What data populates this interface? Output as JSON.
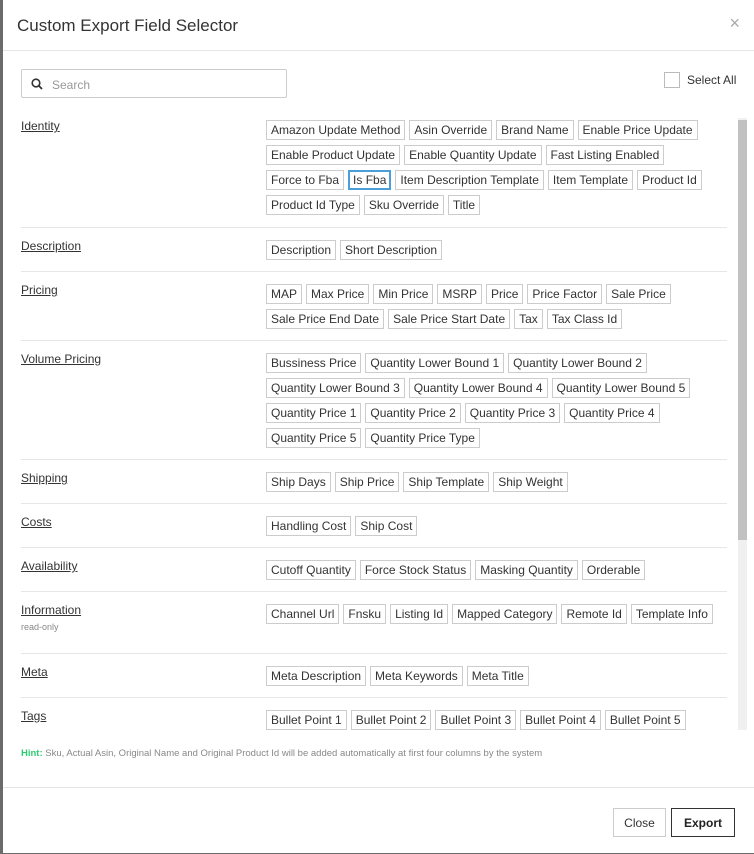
{
  "modal": {
    "title": "Custom Export Field Selector",
    "close_symbol": "×",
    "search": {
      "placeholder": "Search",
      "value": ""
    },
    "select_all_label": "Select All",
    "hint_label": "Hint:",
    "hint_text": "Sku, Actual Asin, Original Name and Original Product Id will be added automatically at first four columns by the system",
    "close_button": "Close",
    "export_button": "Export",
    "accent_color": "#4a9fd8",
    "hint_color": "#2ecc71"
  },
  "sections": [
    {
      "label": "Identity",
      "fields": [
        "Amazon Update Method",
        "Asin Override",
        "Brand Name",
        "Enable Price Update",
        "Enable Product Update",
        "Enable Quantity Update",
        "Fast Listing Enabled",
        "Force to Fba",
        "Is Fba",
        "Item Description Template",
        "Item Template",
        "Product Id",
        "Product Id Type",
        "Sku Override",
        "Title"
      ],
      "selected": [
        "Is Fba"
      ]
    },
    {
      "label": "Description",
      "fields": [
        "Description",
        "Short Description"
      ]
    },
    {
      "label": "Pricing",
      "fields": [
        "MAP",
        "Max Price",
        "Min Price",
        "MSRP",
        "Price",
        "Price Factor",
        "Sale Price",
        "Sale Price End Date",
        "Sale Price Start Date",
        "Tax",
        "Tax Class Id"
      ]
    },
    {
      "label": "Volume Pricing",
      "fields": [
        "Bussiness Price",
        "Quantity Lower Bound 1",
        "Quantity Lower Bound 2",
        "Quantity Lower Bound 3",
        "Quantity Lower Bound 4",
        "Quantity Lower Bound 5",
        "Quantity Price 1",
        "Quantity Price 2",
        "Quantity Price 3",
        "Quantity Price 4",
        "Quantity Price 5",
        "Quantity Price Type"
      ]
    },
    {
      "label": "Shipping",
      "fields": [
        "Ship Days",
        "Ship Price",
        "Ship Template",
        "Ship Weight"
      ]
    },
    {
      "label": "Costs",
      "fields": [
        "Handling Cost",
        "Ship Cost"
      ]
    },
    {
      "label": "Availability",
      "fields": [
        "Cutoff Quantity",
        "Force Stock Status",
        "Masking Quantity",
        "Orderable"
      ]
    },
    {
      "label": "Information",
      "sublabel": "read-only",
      "fields": [
        "Channel Url",
        "Fnsku",
        "Listing Id",
        "Mapped Category",
        "Remote Id",
        "Template Info"
      ]
    },
    {
      "label": "Meta",
      "fields": [
        "Meta Description",
        "Meta Keywords",
        "Meta Title"
      ]
    },
    {
      "label": "Tags",
      "fields": [
        "Bullet Point 1",
        "Bullet Point 2",
        "Bullet Point 3",
        "Bullet Point 4",
        "Bullet Point 5"
      ]
    }
  ]
}
